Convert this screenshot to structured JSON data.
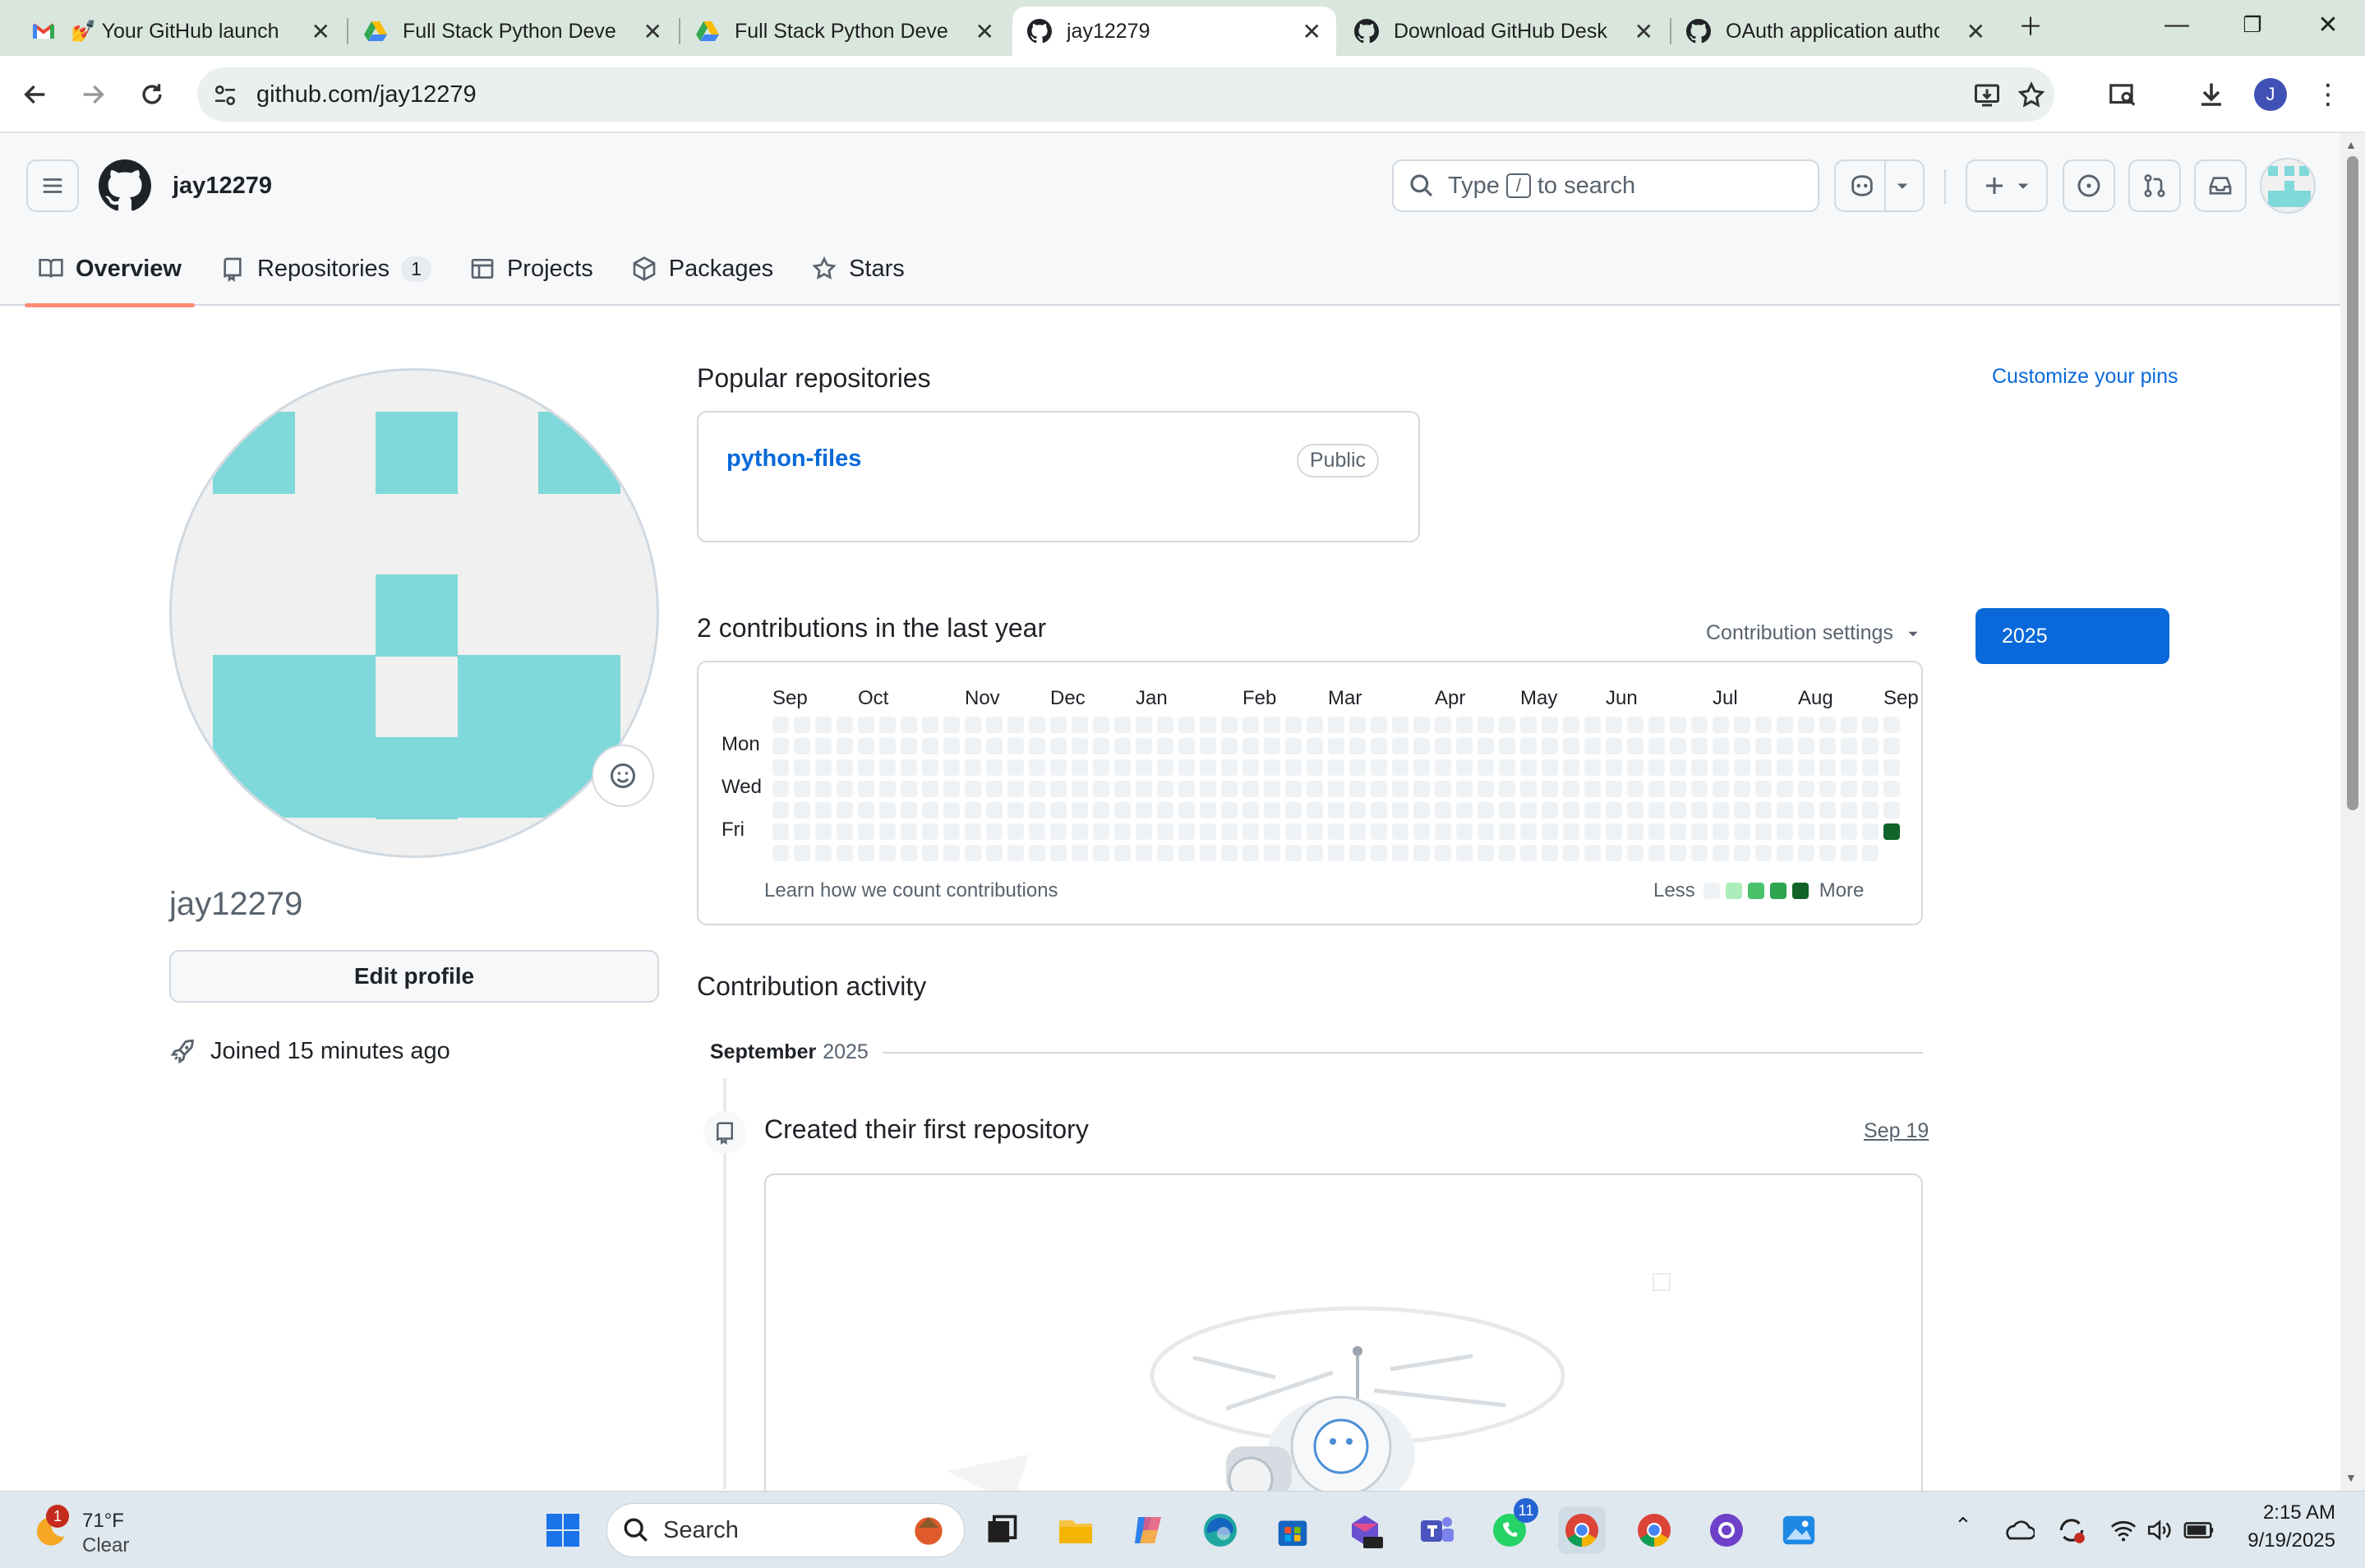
{
  "browser": {
    "tabs": [
      {
        "title": "💅 Your GitHub launch c",
        "icon": "gmail-icon"
      },
      {
        "title": "Full Stack Python Develo",
        "icon": "google-drive-icon"
      },
      {
        "title": "Full Stack Python Develo",
        "icon": "google-drive-icon"
      },
      {
        "title": "jay12279",
        "icon": "github-icon",
        "active": true
      },
      {
        "title": "Download GitHub Deskt",
        "icon": "github-icon"
      },
      {
        "title": "OAuth application autho",
        "icon": "github-icon"
      }
    ],
    "url": "github.com/jay12279",
    "profile_initial": "J"
  },
  "header": {
    "username": "jay12279",
    "search_prefix": "Type",
    "search_key": "/",
    "search_suffix": "to search"
  },
  "nav": {
    "overview": "Overview",
    "repositories": "Repositories",
    "repositories_count": "1",
    "projects": "Projects",
    "packages": "Packages",
    "stars": "Stars"
  },
  "profile": {
    "name": "jay12279",
    "edit_button": "Edit profile",
    "joined": "Joined 15 minutes ago"
  },
  "popular": {
    "title": "Popular repositories",
    "customize": "Customize your pins",
    "repo_name": "python-files",
    "repo_visibility": "Public"
  },
  "contributions": {
    "title": "2 contributions in the last year",
    "settings": "Contribution settings",
    "year": "2025",
    "months": [
      "Sep",
      "Oct",
      "Nov",
      "Dec",
      "Jan",
      "Feb",
      "Mar",
      "Apr",
      "May",
      "Jun",
      "Jul",
      "Aug",
      "Sep"
    ],
    "days": [
      "Mon",
      "Wed",
      "Fri"
    ],
    "learn_link": "Learn how we count contributions",
    "less": "Less",
    "more": "More",
    "colors": {
      "empty": "#eff2f5",
      "l1": "#aceebb",
      "l2": "#4ac26b",
      "l3": "#2da44e",
      "l4": "#116329"
    }
  },
  "activity": {
    "title": "Contribution activity",
    "month": "September",
    "year": "2025",
    "event": "Created their first repository",
    "date": "Sep 19"
  },
  "taskbar": {
    "weather_temp": "71°F",
    "weather_cond": "Clear",
    "weather_badge": "1",
    "search": "Search",
    "whatsapp_badge": "11",
    "time": "2:15 AM",
    "date": "9/19/2025"
  }
}
